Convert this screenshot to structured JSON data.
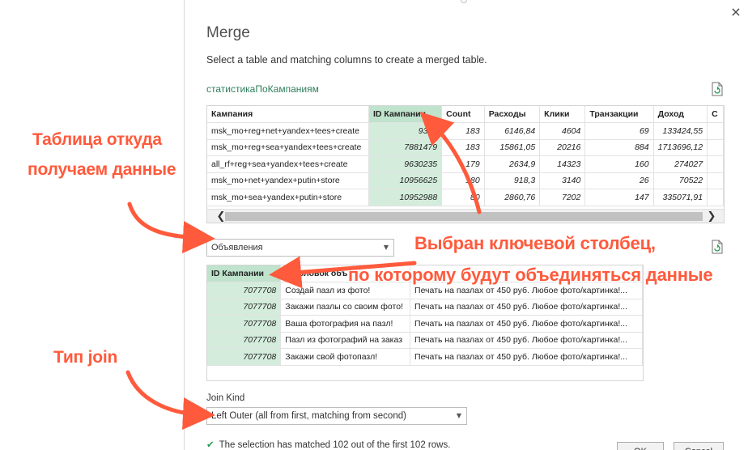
{
  "dialog": {
    "title": "Merge",
    "description": "Select a table and matching columns to create a merged table.",
    "close_glyph": "×"
  },
  "table1": {
    "name": "статистикаПоКампаниям",
    "columns": [
      "Кампания",
      "ID Кампании",
      "Count",
      "Расходы",
      "Клики",
      "Транзакции",
      "Доход",
      "C"
    ],
    "rows": [
      [
        "msk_mo+reg+net+yandex+tees+create",
        "9341",
        "183",
        "6146,84",
        "4604",
        "69",
        "133424,55",
        ""
      ],
      [
        "msk_mo+reg+sea+yandex+tees+create",
        "7881479",
        "183",
        "15861,05",
        "20216",
        "884",
        "1713696,12",
        ""
      ],
      [
        "all_rf+reg+sea+yandex+tees+create",
        "9630235",
        "179",
        "2634,9",
        "14323",
        "160",
        "274027",
        ""
      ],
      [
        "msk_mo+net+yandex+putin+store",
        "10956625",
        "180",
        "918,3",
        "3140",
        "26",
        "70522",
        ""
      ],
      [
        "msk_mo+sea+yandex+putin+store",
        "10952988",
        "80",
        "2860,76",
        "7202",
        "147",
        "335071,91",
        ""
      ]
    ],
    "scroll_left": "❮",
    "scroll_right": "❯"
  },
  "table2": {
    "selected_table": "Объявления",
    "columns": [
      "ID Кампании",
      "Заголовок объ",
      ""
    ],
    "rows": [
      [
        "7077708",
        "Создай пазл из фото!",
        "Печать на пазлах от 450 руб. Любое фото/картинка!..."
      ],
      [
        "7077708",
        "Закажи пазлы со своим фото!",
        "Печать на пазлах от 450 руб. Любое фото/картинка!..."
      ],
      [
        "7077708",
        "Ваша фотография на пазл!",
        "Печать на пазлах от 450 руб. Любое фото/картинка!..."
      ],
      [
        "7077708",
        "Пазл из фотографий на заказ",
        "Печать на пазлах от 450 руб. Любое фото/картинка!..."
      ],
      [
        "7077708",
        "Закажи свой фотопазл!",
        "Печать на пазлах от 450 руб. Любое фото/картинка!..."
      ]
    ]
  },
  "join": {
    "label": "Join Kind",
    "value": "Left Outer (all from first, matching from second)"
  },
  "status": {
    "check": "✔",
    "text": "The selection has matched 102 out of the first 102 rows."
  },
  "buttons": {
    "ok": "OK",
    "cancel": "Cancel"
  },
  "annotations": {
    "source_line1": "Таблица откуда",
    "source_line2": "получаем данные",
    "key_line1": "Выбран ключевой столбец,",
    "key_line2": "по которому будут объединяться данные",
    "join_type": "Тип join"
  },
  "colors": {
    "annotation": "#ff5a3c",
    "selected_column": "#d4ecdc",
    "table_name": "#2e7d5b"
  }
}
